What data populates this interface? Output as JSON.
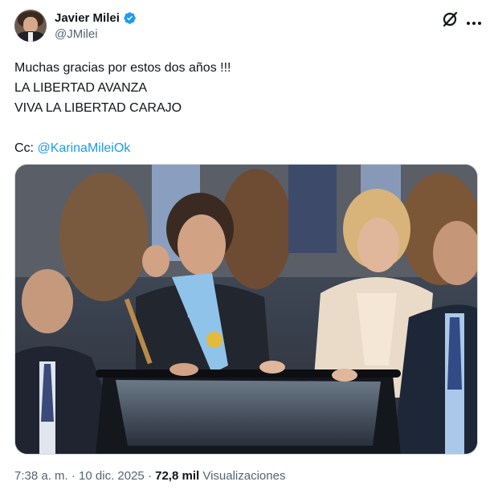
{
  "author": {
    "display_name": "Javier Milei",
    "handle": "@JMilei",
    "verified_badge_color": "#1d9bf0"
  },
  "tweet": {
    "lines": [
      "Muchas gracias por estos dos años !!!",
      "LA LIBERTAD AVANZA",
      "VIVA LA LIBERTAD CARAJO"
    ],
    "cc_prefix": "Cc: ",
    "mention": "@KarinaMileiOk"
  },
  "media": {
    "type": "photo"
  },
  "meta": {
    "time": "7:38 a. m.",
    "separator": "·",
    "date": "10 dic. 2025",
    "views_count": "72,8 mil",
    "views_label": "Visualizaciones"
  },
  "colors": {
    "link": "#1d9bf0",
    "text_primary": "#0f1419",
    "text_secondary": "#536471",
    "border": "#cfd9de"
  },
  "icons": [
    "verified-badge-icon",
    "grok-icon",
    "more-options-icon"
  ]
}
